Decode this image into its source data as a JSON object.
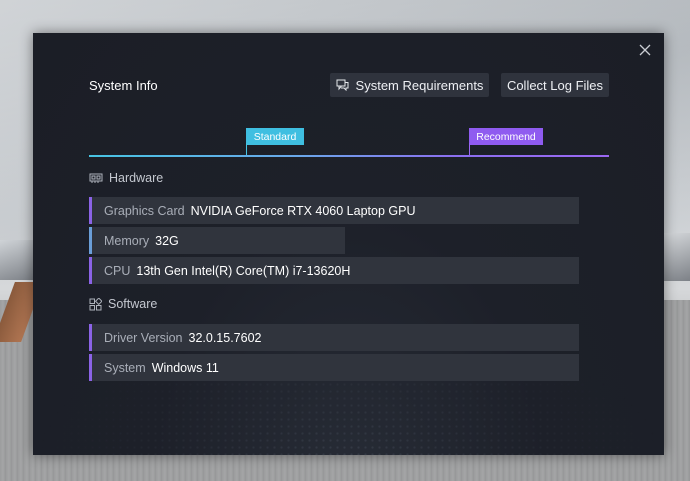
{
  "dialog": {
    "title": "System Info",
    "buttons": {
      "system_requirements": "System Requirements",
      "collect_logs": "Collect Log Files"
    }
  },
  "tiers": {
    "standard": "Standard",
    "recommend": "Recommend"
  },
  "hardware": {
    "heading": "Hardware",
    "rows": [
      {
        "label": "Graphics Card",
        "value": "NVIDIA GeForce RTX 4060 Laptop GPU",
        "accent": "#8b63e6"
      },
      {
        "label": "Memory",
        "value": "32G",
        "accent": "#6a9ed8"
      },
      {
        "label": "CPU",
        "value": "13th Gen Intel(R) Core(TM) i7-13620H",
        "accent": "#8b63e6"
      }
    ]
  },
  "software": {
    "heading": "Software",
    "rows": [
      {
        "label": "Driver Version",
        "value": "32.0.15.7602",
        "accent": "#8b63e6"
      },
      {
        "label": "System",
        "value": "Windows 11",
        "accent": "#8b63e6"
      }
    ]
  },
  "colors": {
    "standard": "#3fbfe1",
    "recommend": "#8f5bf0"
  },
  "icons": {
    "close": "close-icon",
    "requirements": "chat-icon",
    "hardware": "gpu-card-icon",
    "software": "windows-icon"
  }
}
